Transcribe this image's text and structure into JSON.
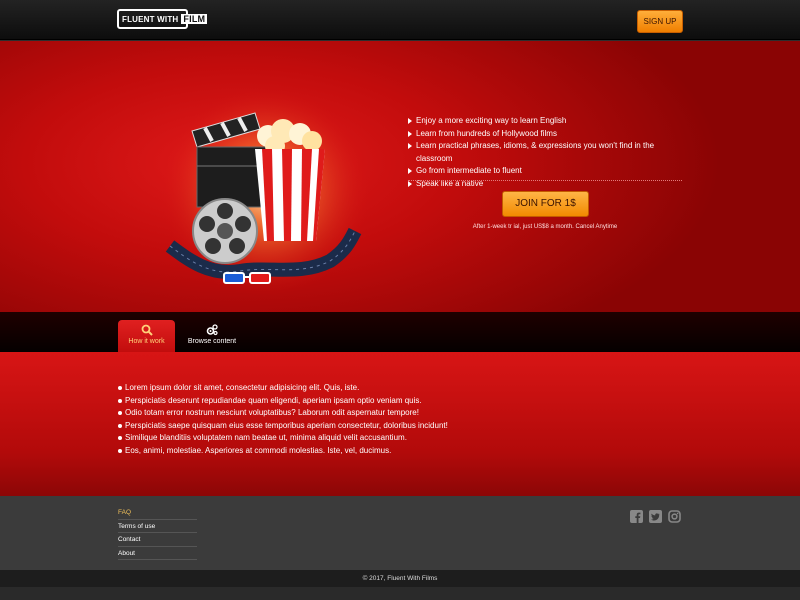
{
  "header": {
    "logo_part1": "FLUENT WITH",
    "logo_part2": "FILM",
    "signup_label": "SIGN UP"
  },
  "hero": {
    "features": [
      "Enjoy a more exciting way to learn English",
      "Learn from hundreds of Hollywood films",
      "Learn practical phrases, idioms, & expressions you won't find in the classroom",
      "Go from intermediate to fluent",
      "Speak like a native"
    ],
    "join_label": "JOIN FOR 1$",
    "trial_text": "After 1-week tr ial, just US$8 a month. Cancel Anytime"
  },
  "tabs": [
    {
      "label": "How it work",
      "icon": "search-icon"
    },
    {
      "label": "Browse content",
      "icon": "gears-icon"
    }
  ],
  "content": {
    "items": [
      "Lorem ipsum dolor sit amet, consectetur adipisicing elit. Quis, iste.",
      "Perspiciatis deserunt repudiandae quam eligendi, aperiam ipsam optio veniam quis.",
      "Odio totam error nostrum nesciunt voluptatibus? Laborum odit aspernatur tempore!",
      "Perspiciatis saepe quisquam eius esse temporibus aperiam consectetur, doloribus incidunt!",
      "Similique blanditiis voluptatem nam beatae ut, minima aliquid velit accusantium.",
      "Eos, animi, molestiae. Asperiores at commodi molestias. Iste, vel, ducimus."
    ]
  },
  "footer": {
    "links": [
      "FAQ",
      "Terms of use",
      "Contact",
      "About"
    ],
    "social": [
      "facebook-icon",
      "twitter-icon",
      "instagram-icon"
    ],
    "copyright": "© 2017, Fluent With Films"
  },
  "colors": {
    "accent_orange": "#f28a00",
    "hero_red": "#c20c0c",
    "faq_gold": "#f1c15a"
  }
}
